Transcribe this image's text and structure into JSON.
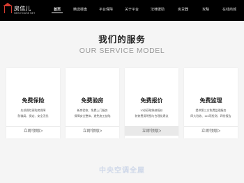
{
  "logo": {
    "text": "房信儿",
    "subtext": "NEW HOUSE NET"
  },
  "nav": {
    "items": [
      "首页",
      "精选楼盘",
      "平台保障",
      "关于平台",
      "法律援助",
      "房贷器",
      "攻略",
      "在线商城"
    ],
    "active_index": 0
  },
  "section": {
    "title": "我们的服务",
    "subtitle": "OUR SERVICE MODEL"
  },
  "cards": [
    {
      "title": "免费保险",
      "line1": "先领保险再购房保障",
      "line2": "防骗局、保定、安全无忧",
      "button": "立即领取>"
    },
    {
      "title": "免费验房",
      "line1": "新房验收、免费上门服务",
      "line2": "保障安全整体、避免施工缺陷",
      "button": "立即领取>"
    },
    {
      "title": "免费报价",
      "line1": "10秒获取装修报价",
      "line2": "装修费用明细与合理化建议",
      "button": "立即领取>"
    },
    {
      "title": "免费监理",
      "line1": "提供第三方免费监理服务",
      "line2": "四大验收、110项检测、四份报告",
      "button": "立即领取>"
    }
  ],
  "watermark": "中央空调全屋"
}
